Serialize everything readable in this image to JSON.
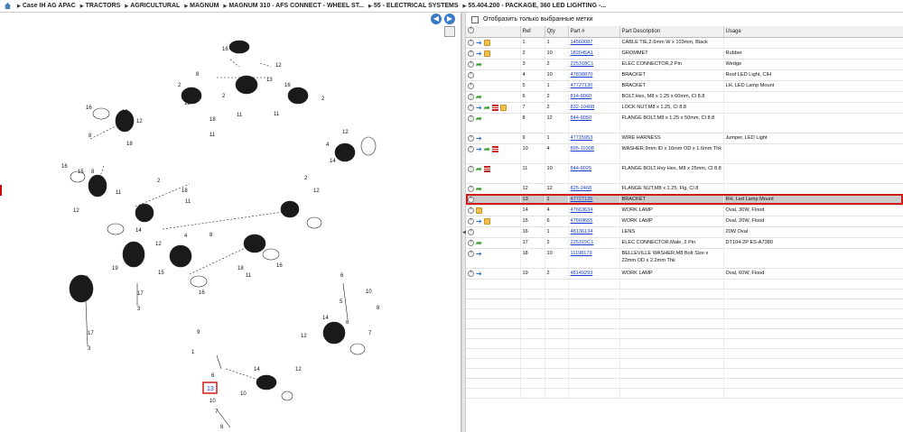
{
  "breadcrumb": {
    "items": [
      "Case IH AG APAC",
      "TRACTORS",
      "AGRICULTURAL",
      "MAGNUM",
      "MAGNUM 310 - AFS CONNECT - WHEEL ST...",
      "55 - ELECTRICAL SYSTEMS",
      "55.404.200 - PACKAGE, 360 LED LIGHTING -..."
    ]
  },
  "filter": {
    "checkbox_label": "Отобразить только выбранные метки"
  },
  "table": {
    "headers": [
      "",
      "Ref",
      "Qty",
      "Part #",
      "Part Description",
      "Usage"
    ],
    "rows": [
      {
        "ref": "1",
        "qty": "1",
        "part": "14560087",
        "desc": "CABLE TIE,2.6mm W x 103mm, Black",
        "usage": ""
      },
      {
        "ref": "2",
        "qty": "10",
        "part": "182045A1",
        "desc": "GROMMET",
        "usage": "Rubber"
      },
      {
        "ref": "3",
        "qty": "2",
        "part": "225318C1",
        "desc": "ELEC CONNECTOR,2 Pin",
        "usage": "Wedge"
      },
      {
        "ref": "4",
        "qty": "10",
        "part": "47838870",
        "desc": "BRACKET",
        "usage": "Roof LED Light, CIH"
      },
      {
        "ref": "5",
        "qty": "1",
        "part": "47727130",
        "desc": "BRACKET",
        "usage": "LH, LED Lamp Mount"
      },
      {
        "ref": "6",
        "qty": "2",
        "part": "814-8060",
        "desc": "BOLT,Hex, M8 x 1.25 x 60mm, Cl 8.8",
        "usage": ""
      },
      {
        "ref": "7",
        "qty": "2",
        "part": "832-10408",
        "desc": "LOCK NUT,M8 x 1.25, Cl 8.8",
        "usage": ""
      },
      {
        "ref": "8",
        "qty": "12",
        "part": "844-8050",
        "desc": "FLANGE BOLT,M8 x 1.25 x 50mm, Cl 8.8",
        "usage": ""
      },
      {
        "ref": "9",
        "qty": "1",
        "part": "47715953",
        "desc": "WIRE HARNESS",
        "usage": "Jumper, LED Light"
      },
      {
        "ref": "10",
        "qty": "4",
        "part": "895-11008",
        "desc": "WASHER,9mm ID x 16mm OD x 1.6mm Thk",
        "usage": ""
      },
      {
        "ref": "11",
        "qty": "10",
        "part": "844-8025",
        "desc": "FLANGE BOLT,Hvy Hex, M8 x 25mm, Cl 8.8",
        "usage": ""
      },
      {
        "ref": "12",
        "qty": "12",
        "part": "825-2468",
        "desc": "FLANGE NUT,M8 x 1.25, Flg, Cl 8",
        "usage": ""
      },
      {
        "ref": "13",
        "qty": "1",
        "part": "47727135",
        "desc": "BRACKET",
        "usage": "RH, Led Lamp Mount"
      },
      {
        "ref": "14",
        "qty": "4",
        "part": "47663634",
        "desc": "WORK LAMP",
        "usage": "Oval, 30W, Flood"
      },
      {
        "ref": "15",
        "qty": "6",
        "part": "47669665",
        "desc": "WORK LAMP",
        "usage": "Oval, 20W, Flood"
      },
      {
        "ref": "16",
        "qty": "1",
        "part": "48136134",
        "desc": "LENS",
        "usage": "20W Oval"
      },
      {
        "ref": "17",
        "qty": "2",
        "part": "225315C1",
        "desc": "ELEC CONNECTOR,Male, 2 Pin",
        "usage": "DT104-2P ES-A7380"
      },
      {
        "ref": "18",
        "qty": "10",
        "part": "11198179",
        "desc": "BELLEVILLE WASHER,M8 Bolt Size x 22mm OD x 2.2mm Thk",
        "usage": ""
      },
      {
        "ref": "19",
        "qty": "2",
        "part": "48149293",
        "desc": "WORK LAMP",
        "usage": "Oval, 60W, Flood"
      }
    ],
    "icon_sets": [
      [
        "add-icon",
        "info-icon",
        "box-icon"
      ],
      [
        "add-icon",
        "info-icon",
        "box-icon"
      ],
      [
        "add-icon",
        "arrow-icon"
      ],
      [
        "add-icon"
      ],
      [
        "add-icon"
      ],
      [
        "add-icon",
        "arrow-icon"
      ],
      [
        "add-icon",
        "info-icon",
        "arrow-icon",
        "list-icon",
        "box-icon"
      ],
      [
        "add-icon",
        "arrow-icon"
      ],
      [
        "add-icon",
        "info-icon"
      ],
      [
        "add-icon",
        "info-icon",
        "arrow-icon",
        "list-icon"
      ],
      [
        "add-icon",
        "arrow-icon",
        "list-icon"
      ],
      [
        "add-icon",
        "arrow-icon"
      ],
      [
        "add-icon"
      ],
      [
        "add-icon",
        "box-icon"
      ],
      [
        "add-icon",
        "info-icon",
        "box-icon"
      ],
      [
        "add-icon"
      ],
      [
        "add-icon",
        "arrow-icon"
      ],
      [
        "add-icon",
        "info-icon"
      ],
      [
        "add-icon",
        "info-icon"
      ]
    ],
    "selected_ref": "13"
  },
  "diagram": {
    "highlighted_ref": "13",
    "callouts": [
      "1",
      "2",
      "3",
      "4",
      "5",
      "6",
      "7",
      "8",
      "9",
      "10",
      "11",
      "12",
      "13",
      "14",
      "15",
      "16",
      "17",
      "18",
      "19"
    ]
  },
  "colors": {
    "link": "#1a3fc8",
    "selected_outline": "#d21a1a",
    "selected_bg": "#cbcbcb",
    "nav_button": "#3a78c8"
  }
}
